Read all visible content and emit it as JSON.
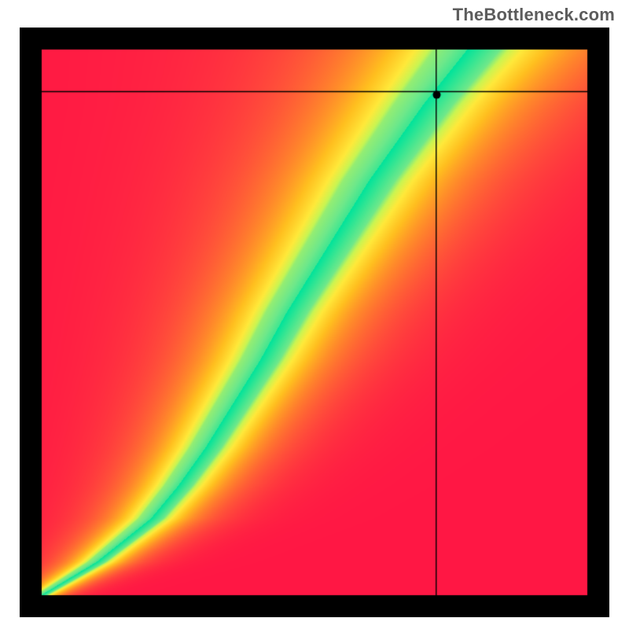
{
  "attribution": "TheBottleneck.com",
  "chart_data": {
    "type": "heatmap",
    "title": "",
    "xlabel": "",
    "ylabel": "",
    "xlim": [
      0,
      1
    ],
    "ylim": [
      0,
      1
    ],
    "grid": false,
    "legend": false,
    "border_px": 28,
    "crosshair": {
      "x": 0.723,
      "y": 0.923
    },
    "marker": {
      "x": 0.724,
      "y": 0.917,
      "radius": 5
    },
    "ridge": {
      "description": "Centerline of the green ideal-fit band in normalized (x,y) units, bottom-left origin.",
      "points": [
        [
          0.0,
          0.0
        ],
        [
          0.05,
          0.03
        ],
        [
          0.1,
          0.06
        ],
        [
          0.15,
          0.1
        ],
        [
          0.2,
          0.14
        ],
        [
          0.25,
          0.2
        ],
        [
          0.3,
          0.27
        ],
        [
          0.35,
          0.35
        ],
        [
          0.4,
          0.43
        ],
        [
          0.45,
          0.52
        ],
        [
          0.5,
          0.6
        ],
        [
          0.55,
          0.68
        ],
        [
          0.6,
          0.76
        ],
        [
          0.65,
          0.83
        ],
        [
          0.7,
          0.9
        ],
        [
          0.74,
          0.95
        ],
        [
          0.78,
          1.0
        ]
      ],
      "half_width_start": 0.01,
      "half_width_end": 0.06
    },
    "colormap": {
      "stops": [
        [
          0.0,
          "#ff1744"
        ],
        [
          0.18,
          "#ff4d3a"
        ],
        [
          0.38,
          "#ff8a2a"
        ],
        [
          0.55,
          "#ffbf1f"
        ],
        [
          0.72,
          "#ffe93a"
        ],
        [
          0.84,
          "#c9f552"
        ],
        [
          0.93,
          "#6fe88a"
        ],
        [
          1.0,
          "#00e39b"
        ]
      ]
    }
  }
}
